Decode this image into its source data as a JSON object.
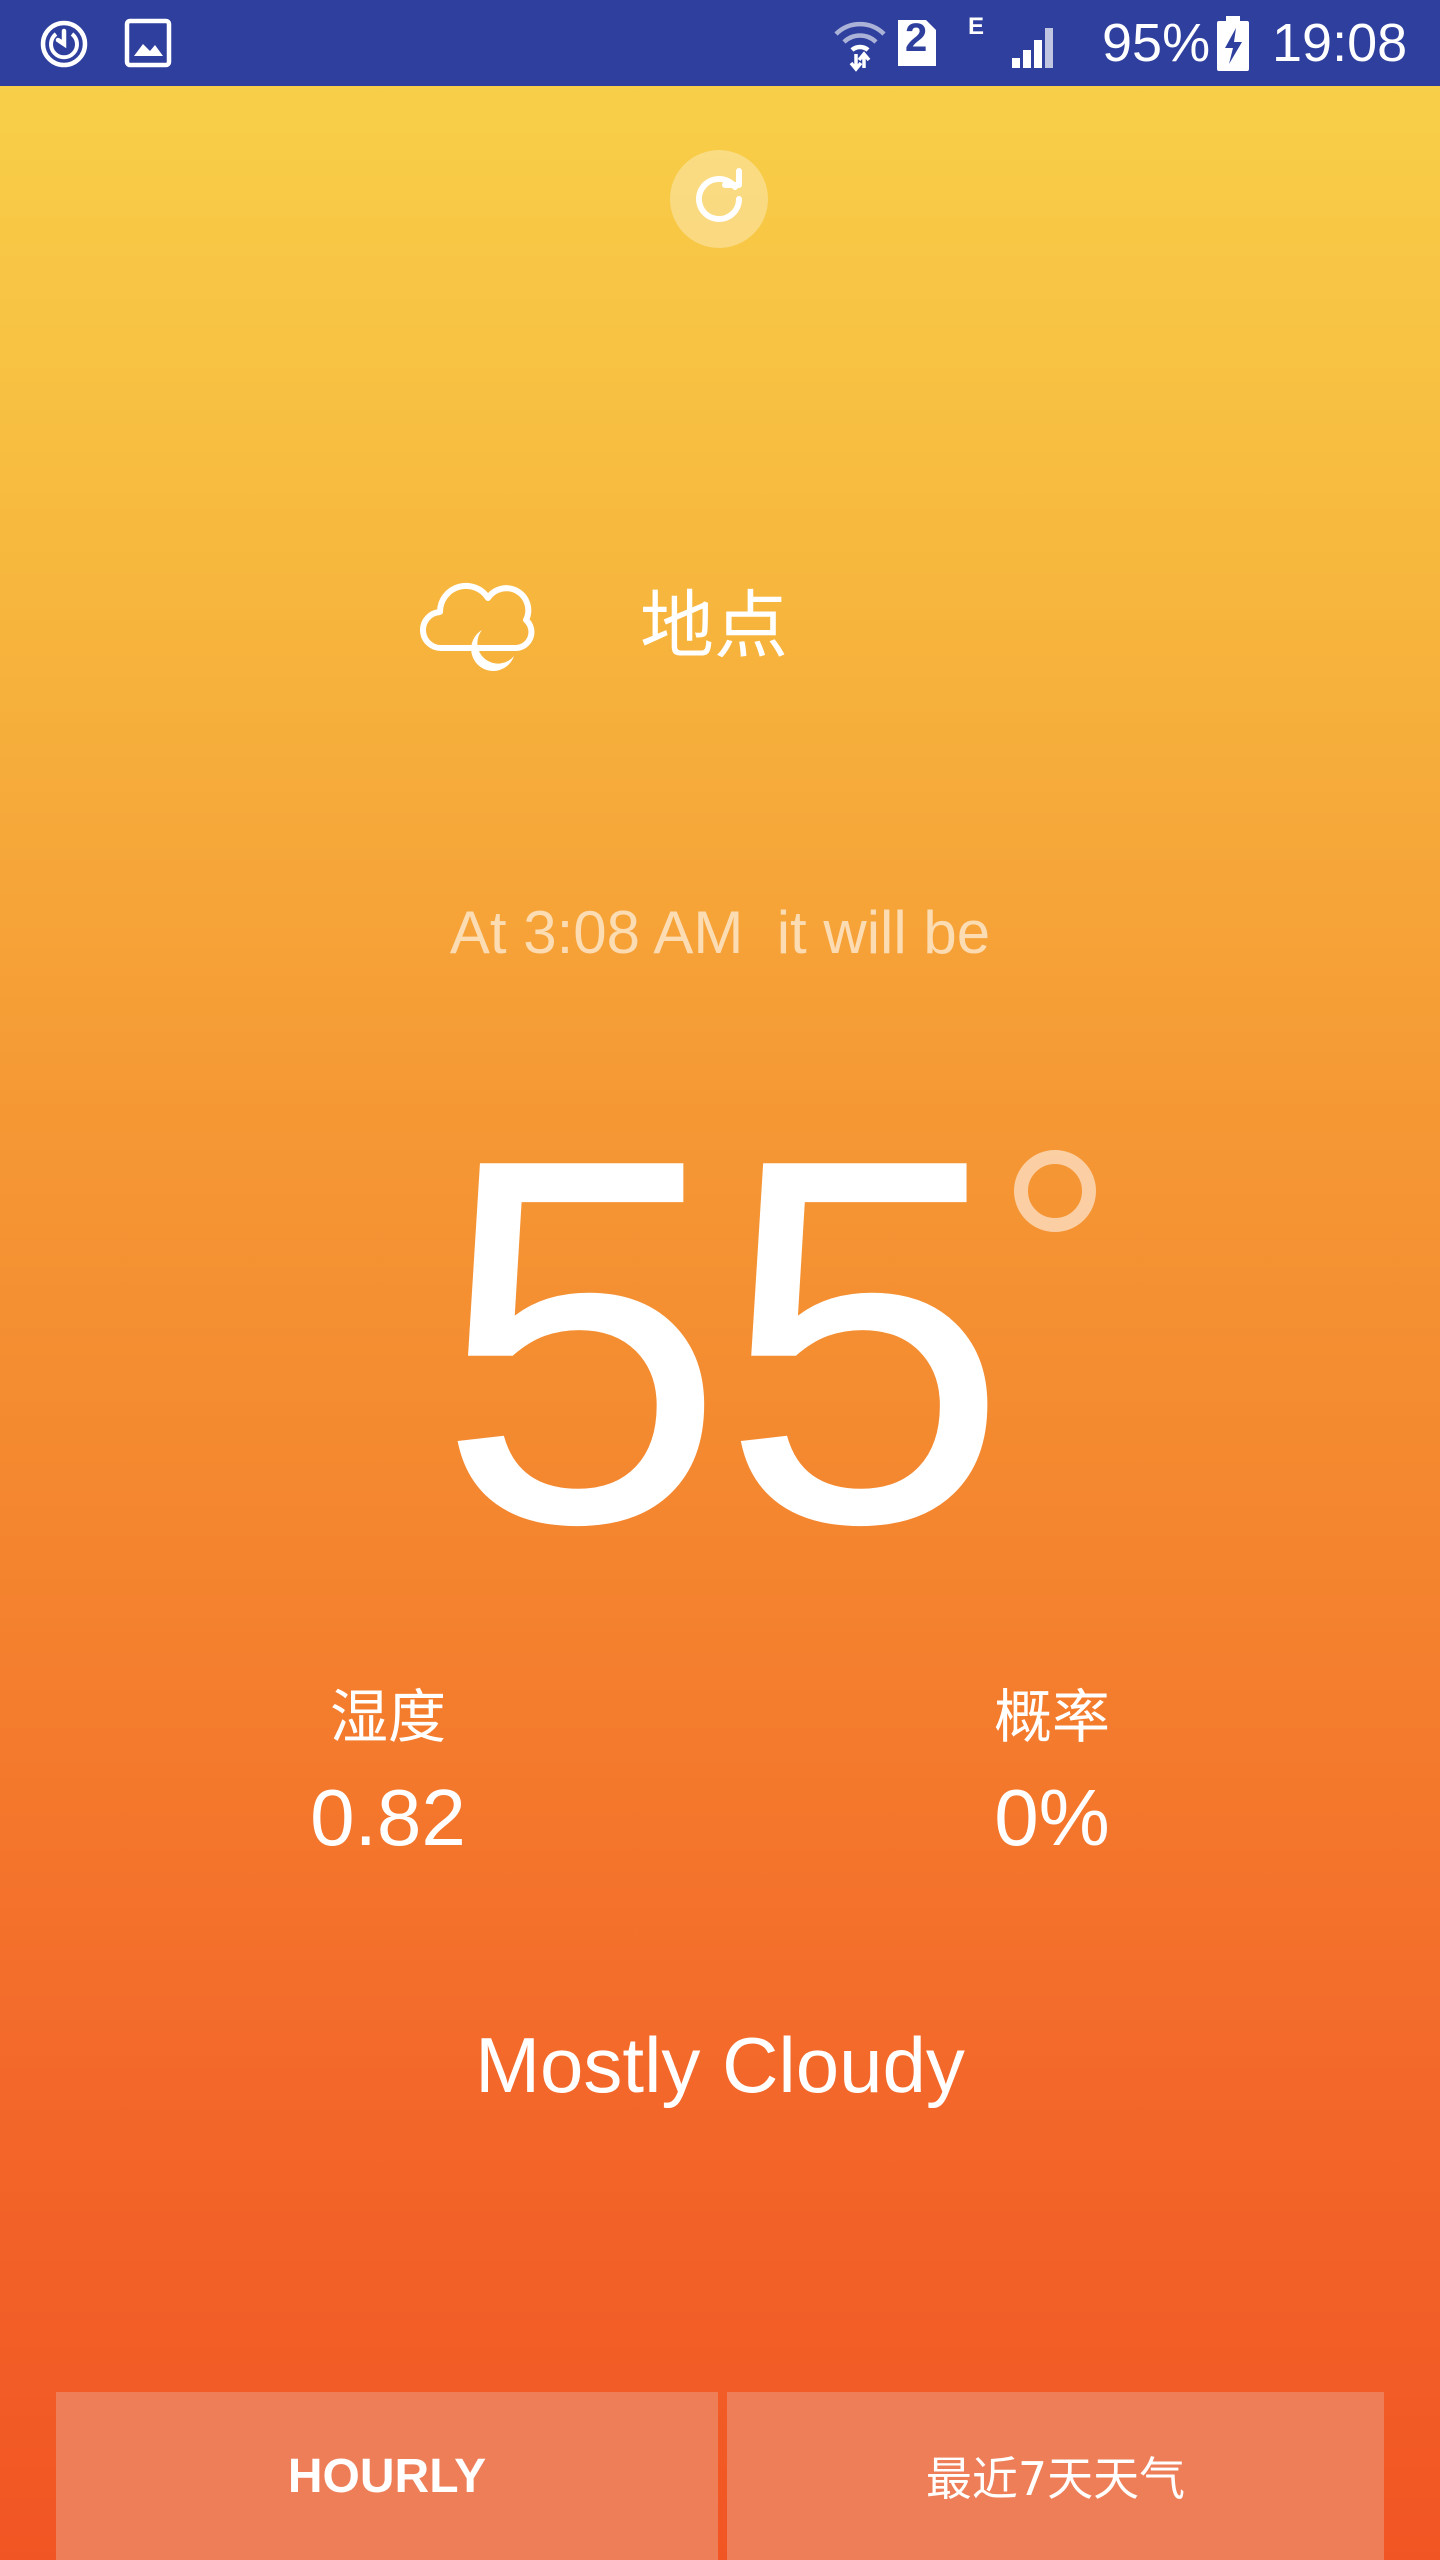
{
  "status_bar": {
    "icons": [
      "sync-icon",
      "gallery-icon",
      "wifi-icon",
      "sim-2-icon",
      "network-e-icon",
      "signal-icon",
      "battery-charging-icon"
    ],
    "network_type": "E",
    "sim_label": "2",
    "battery": "95%",
    "time": "19:08"
  },
  "header": {
    "refresh_icon": "refresh-icon"
  },
  "location": {
    "weather_icon": "cloudy-night-icon",
    "name": "地点"
  },
  "forecast": {
    "time_text": "At 3:08 AM  it will be",
    "temperature": "55",
    "degree_icon": "degree-icon"
  },
  "stats": {
    "humidity_label": "湿度",
    "humidity_value": "0.82",
    "precip_label": "概率",
    "precip_value": "0%"
  },
  "summary": "Mostly Cloudy",
  "buttons": {
    "hourly": "HOURLY",
    "weekly": "最近7天天气"
  },
  "colors": {
    "status_bar": "#2E3F9E",
    "gradient_top": "#F8D34A",
    "gradient_bottom": "#F15523",
    "button_bg": "#EE7E58",
    "text": "#FFFFFF"
  }
}
